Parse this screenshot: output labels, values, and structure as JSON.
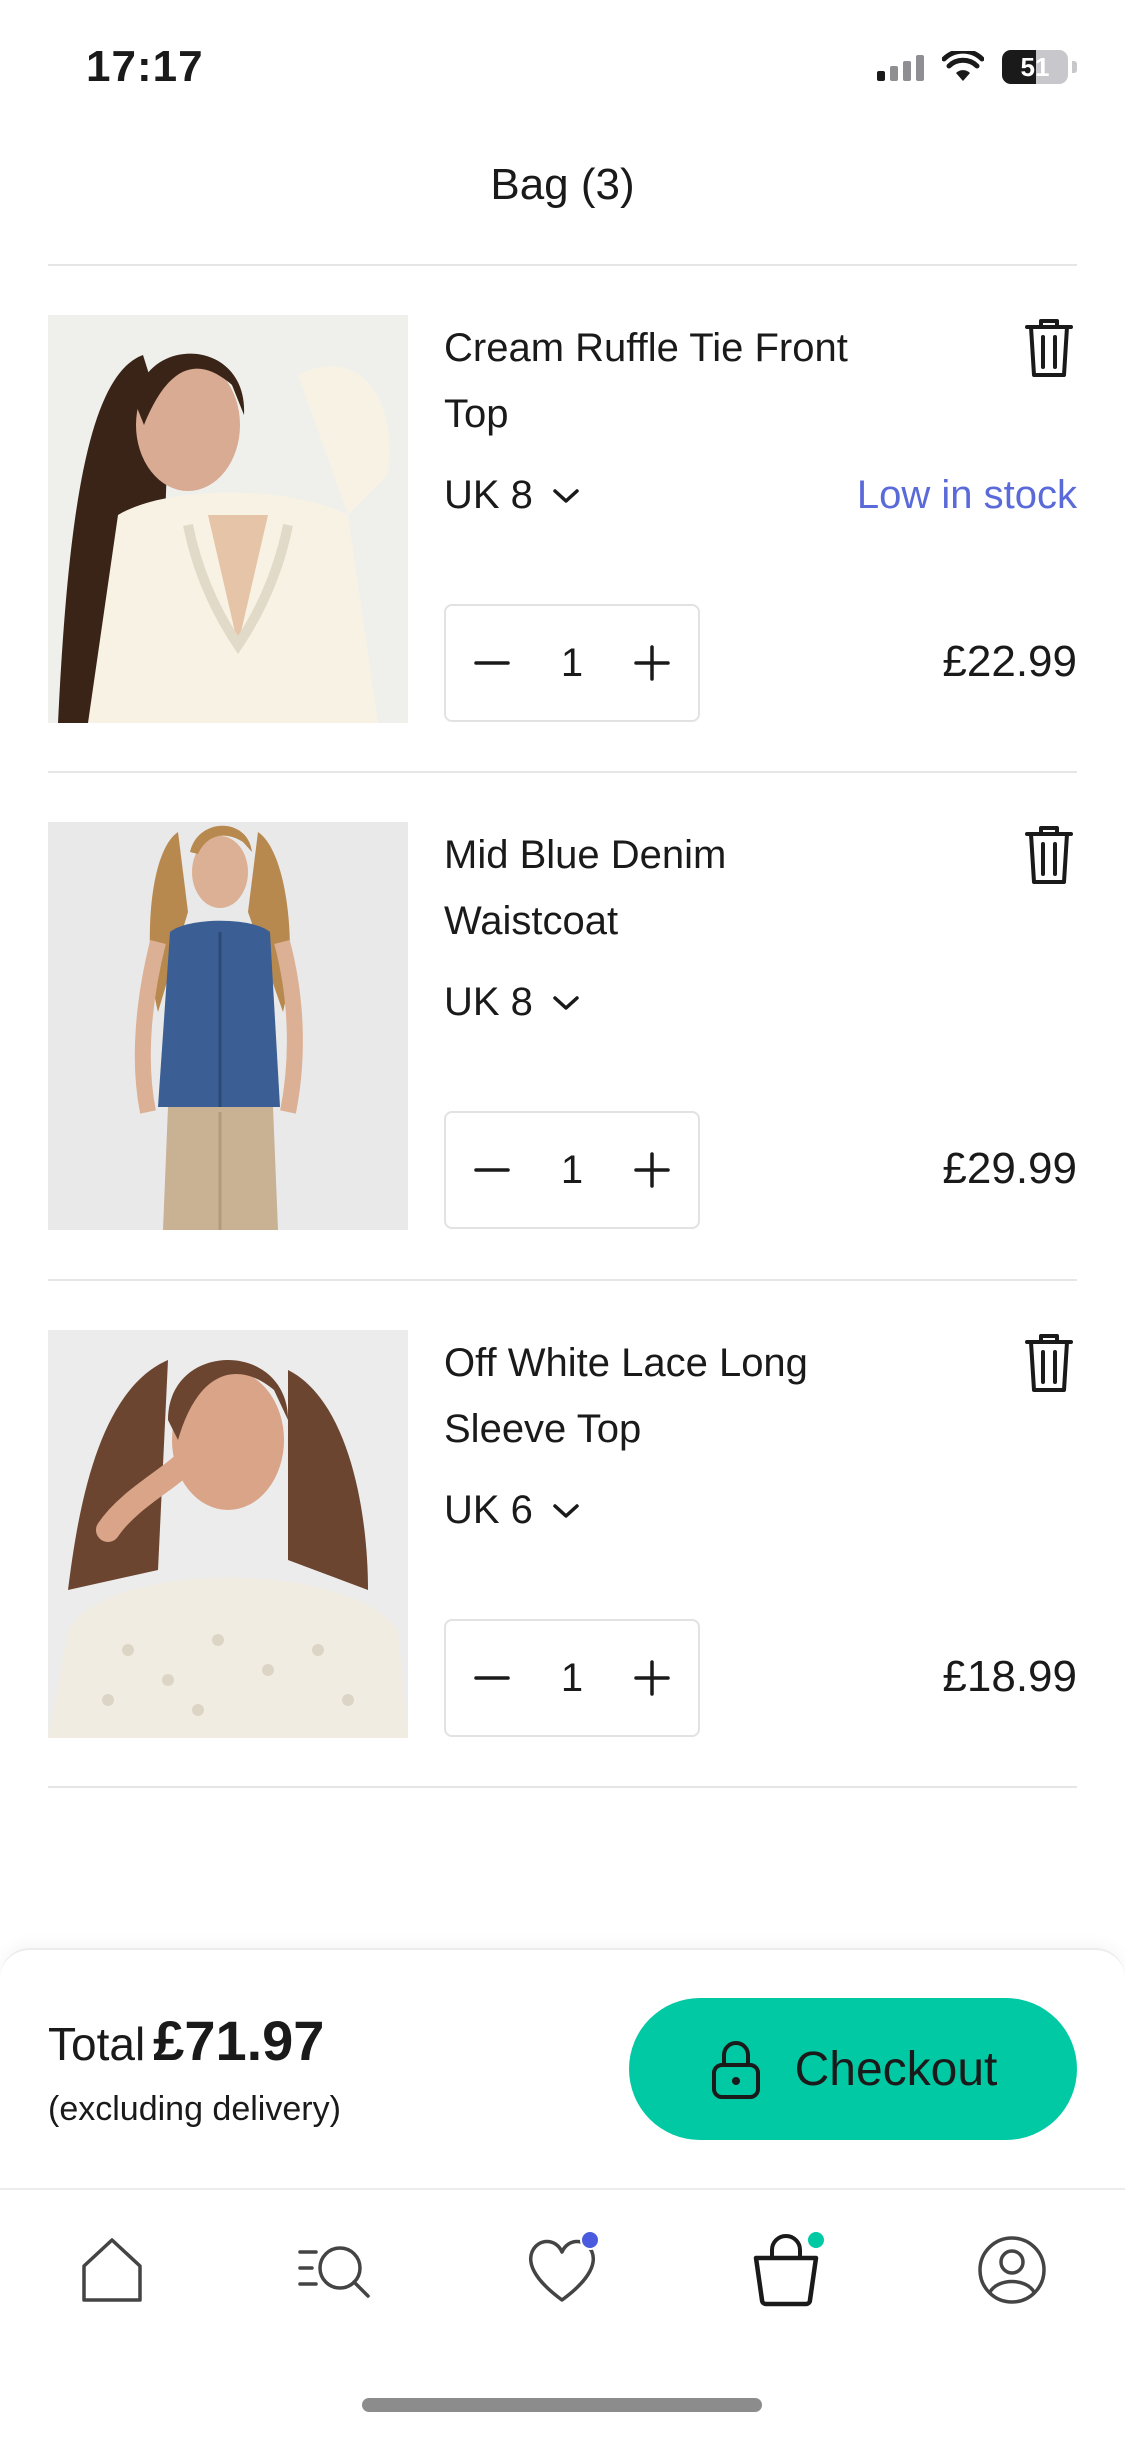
{
  "status": {
    "time": "17:17",
    "battery": "51",
    "battery_level": 0.51
  },
  "header": {
    "title": "Bag (3)"
  },
  "items": [
    {
      "name": "Cream Ruffle Tie Front Top",
      "size": "UK 8",
      "stock": "Low in stock",
      "qty": "1",
      "price": "£22.99",
      "image": "model-cream-ruffle-top-photo"
    },
    {
      "name": "Mid Blue Denim Waistcoat",
      "size": "UK 8",
      "stock": "",
      "qty": "1",
      "price": "£29.99",
      "image": "model-denim-waistcoat-photo"
    },
    {
      "name": "Off White Lace Long Sleeve Top",
      "size": "UK 6",
      "stock": "",
      "qty": "1",
      "price": "£18.99",
      "image": "model-lace-top-photo"
    }
  ],
  "summary": {
    "total_label": "Total",
    "total": "£71.97",
    "note": "(excluding delivery)",
    "checkout_label": "Checkout"
  },
  "tabs": [
    {
      "icon": "home-icon",
      "badge": false
    },
    {
      "icon": "search-icon",
      "badge": false
    },
    {
      "icon": "heart-icon",
      "badge": true,
      "badge_color": "#4a5be0"
    },
    {
      "icon": "bag-icon",
      "badge": true,
      "badge_color": "#00c9a4"
    },
    {
      "icon": "profile-icon",
      "badge": false
    }
  ],
  "colors": {
    "accent": "#00c9a4",
    "stock": "#5a6ad8",
    "heart_badge": "#4a5be0"
  }
}
